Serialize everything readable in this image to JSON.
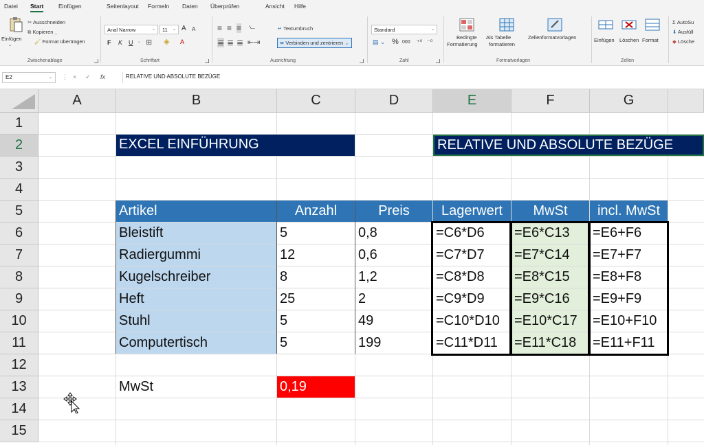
{
  "ribbon": {
    "tabs": [
      "Datei",
      "Start",
      "Einfügen",
      "Seitenlayout",
      "Formeln",
      "Daten",
      "Überprüfen",
      "Ansicht",
      "Hilfe"
    ],
    "active_tab": "Start",
    "clipboard": {
      "paste": "Einfügen",
      "cut": "Ausschneiden",
      "copy": "Kopieren",
      "format_painter": "Format übertragen",
      "group": "Zwischenablage"
    },
    "font": {
      "family": "Arial Narrow",
      "size": "11",
      "bold": "F",
      "italic": "K",
      "underline": "U",
      "grow": "A",
      "shrink": "A",
      "group": "Schriftart"
    },
    "alignment": {
      "wrap_text": "Textumbruch",
      "merge_center": "Verbinden und zentrieren",
      "group": "Ausrichtung"
    },
    "number": {
      "format": "Standard",
      "percent": "%",
      "thousands": "000",
      "group": "Zahl"
    },
    "styles": {
      "conditional": "Bedingte",
      "conditional_2": "Formatierung",
      "as_table": "Als Tabelle",
      "as_table_2": "formatieren",
      "cell_styles": "Zellenformatvorlagen",
      "group": "Formatvorlagen"
    },
    "cells": {
      "insert": "Einfügen",
      "delete": "Löschen",
      "format": "Format",
      "group": "Zellen"
    },
    "editing": {
      "autosum": "AutoSu",
      "fill": "Ausfüll",
      "clear": "Lösche"
    }
  },
  "formula_bar": {
    "name_box": "E2",
    "cancel": "×",
    "enter": "✓",
    "fx": "fx",
    "value": "RELATIVE UND ABSOLUTE BEZÜGE"
  },
  "grid": {
    "columns": [
      "A",
      "B",
      "C",
      "D",
      "E",
      "F",
      "G"
    ],
    "selected_column": "E",
    "rows": [
      "1",
      "2",
      "3",
      "4",
      "5",
      "6",
      "7",
      "8",
      "9",
      "10",
      "11",
      "12",
      "13",
      "14",
      "15"
    ],
    "selected_row": "2",
    "title_b2": "EXCEL EINFÜHRUNG",
    "title_e2": "RELATIVE UND ABSOLUTE BEZÜGE",
    "headers": [
      "Artikel",
      "Anzahl",
      "Preis",
      "Lagerwert",
      "MwSt",
      "incl. MwSt"
    ],
    "data_rows": [
      {
        "artikel": "Bleistift",
        "anzahl": "5",
        "preis": "0,8",
        "lagerwert": "=C6*D6",
        "mwst": "=E6*C13",
        "incl": "=E6+F6"
      },
      {
        "artikel": "Radiergummi",
        "anzahl": "12",
        "preis": "0,6",
        "lagerwert": "=C7*D7",
        "mwst": "=E7*C14",
        "incl": "=E7+F7"
      },
      {
        "artikel": "Kugelschreiber",
        "anzahl": "8",
        "preis": "1,2",
        "lagerwert": "=C8*D8",
        "mwst": "=E8*C15",
        "incl": "=E8+F8"
      },
      {
        "artikel": "Heft",
        "anzahl": "25",
        "preis": "2",
        "lagerwert": "=C9*D9",
        "mwst": "=E9*C16",
        "incl": "=E9+F9"
      },
      {
        "artikel": "Stuhl",
        "anzahl": "5",
        "preis": "49",
        "lagerwert": "=C10*D10",
        "mwst": "=E10*C17",
        "incl": "=E10+F10"
      },
      {
        "artikel": "Computertisch",
        "anzahl": "5",
        "preis": "199",
        "lagerwert": "=C11*D11",
        "mwst": "=E11*C18",
        "incl": "=E11+F11"
      }
    ],
    "mwst_label": "MwSt",
    "mwst_value": "0,19"
  },
  "colors": {
    "navy": "#002060",
    "header_blue": "#2f75b5",
    "light_blue": "#bdd7ee",
    "light_green": "#e2efda",
    "red": "#ff0000",
    "accent_green": "#217346"
  }
}
